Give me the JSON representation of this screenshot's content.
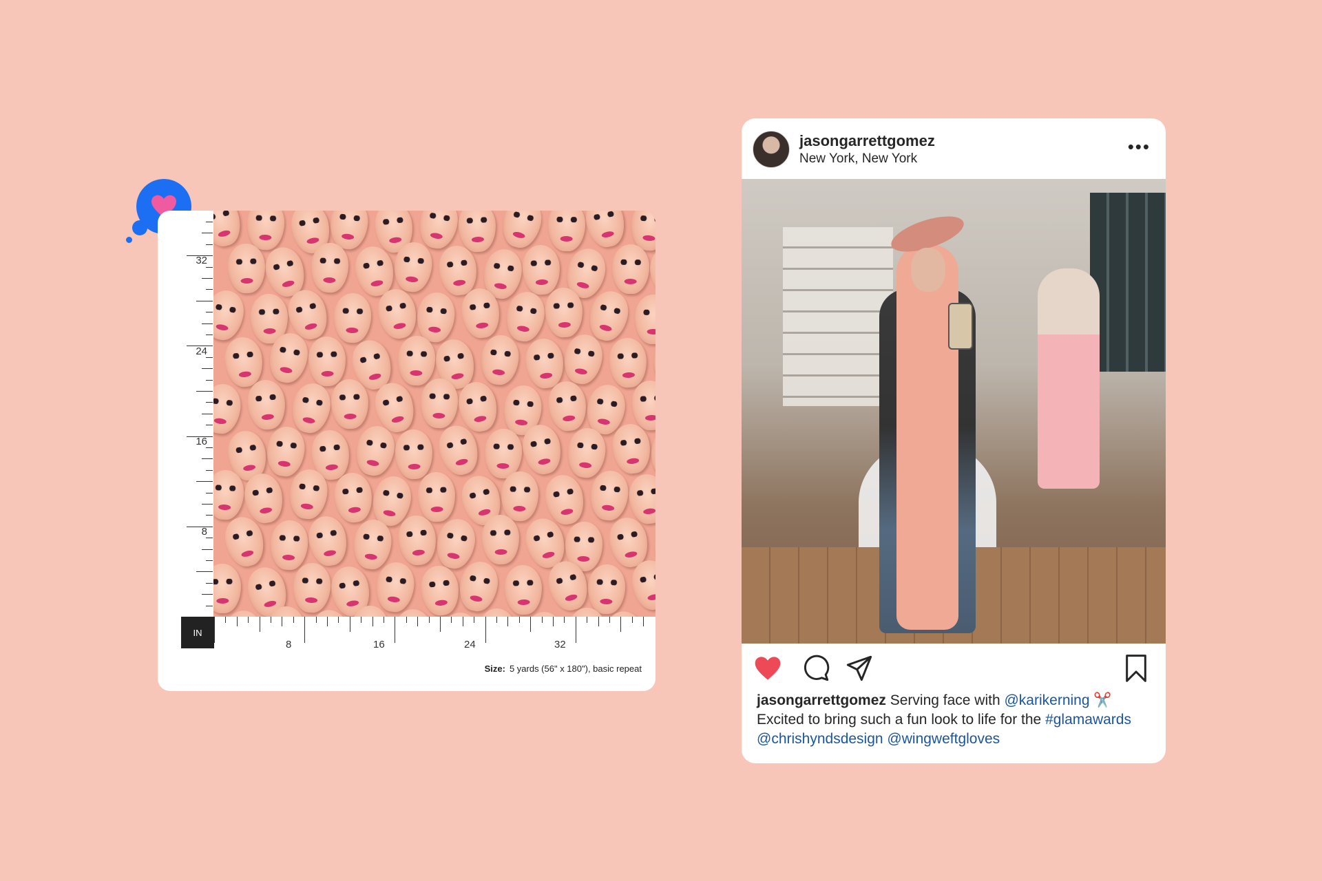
{
  "fabric": {
    "vertical_ruler_labels": [
      "32",
      "24",
      "16",
      "8"
    ],
    "horizontal_ruler_labels": [
      "8",
      "16",
      "24",
      "32"
    ],
    "unit": "IN",
    "size_label": "Size:",
    "size_value": "5 yards (56\" x 180\"), basic repeat"
  },
  "instagram": {
    "username": "jasongarrettgomez",
    "location": "New York, New York",
    "more": "•••",
    "caption": {
      "username": "jasongarrettgomez",
      "text1": "Serving face with",
      "mention1": "@karikerning",
      "emoji": "✂️",
      "text2": "Excited to bring such a fun look to life for the",
      "hashtag": "#glamawards",
      "mention2": "@chrishyndsdesign",
      "mention3": "@wingweftgloves"
    }
  },
  "colors": {
    "background": "#f8c6b8",
    "accent_blue": "#1c6ef2",
    "heart_pink": "#f05aa0",
    "like_red": "#ed4956",
    "link_blue": "#1a56a0"
  },
  "icons": {
    "favorite_bubble": "heart-icon",
    "like": "heart-filled-icon",
    "comment": "comment-icon",
    "share": "send-icon",
    "save": "bookmark-icon",
    "more": "more-icon"
  }
}
